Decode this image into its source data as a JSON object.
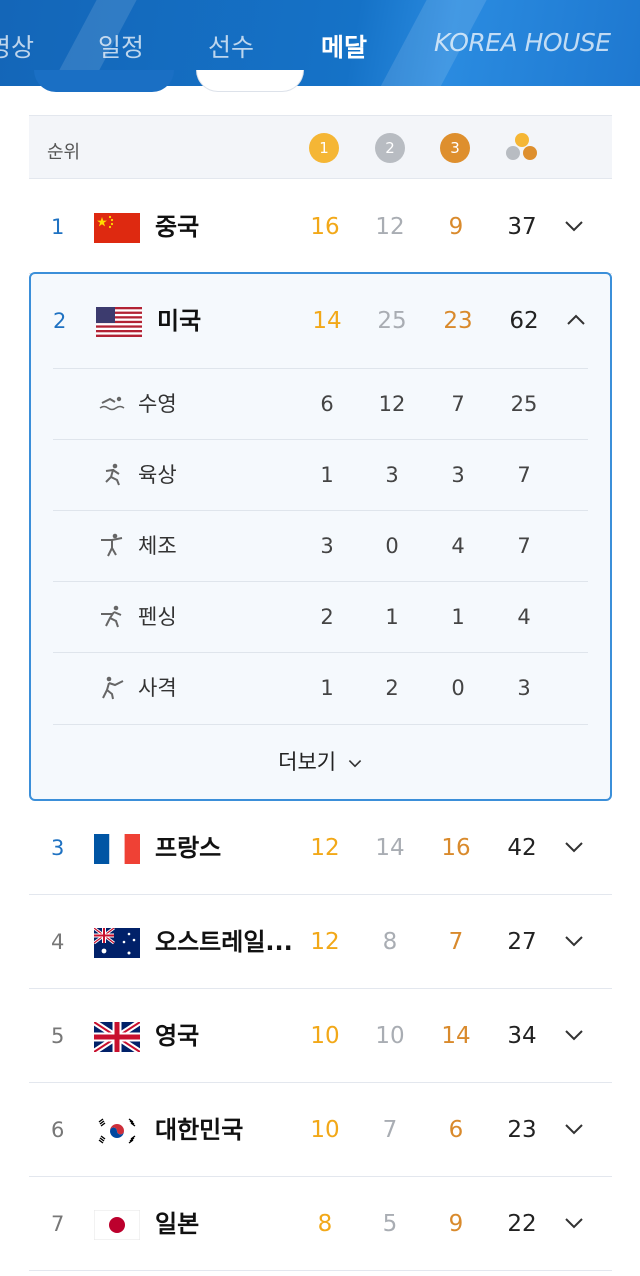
{
  "nav": {
    "items": [
      "영상",
      "일정",
      "선수",
      "메달",
      "KOREA HOUSE"
    ],
    "active": "메달"
  },
  "table": {
    "rank_header": "순위",
    "medal_headers": {
      "gold": "1",
      "silver": "2",
      "bronze": "3"
    }
  },
  "rows": [
    {
      "rank": "1",
      "country": "중국",
      "gold": "16",
      "silver": "12",
      "bronze": "9",
      "total": "37",
      "expanded": false
    },
    {
      "rank": "2",
      "country": "미국",
      "gold": "14",
      "silver": "25",
      "bronze": "23",
      "total": "62",
      "expanded": true
    },
    {
      "rank": "3",
      "country": "프랑스",
      "gold": "12",
      "silver": "14",
      "bronze": "16",
      "total": "42",
      "expanded": false
    },
    {
      "rank": "4",
      "country": "오스트레일...",
      "gold": "12",
      "silver": "8",
      "bronze": "7",
      "total": "27",
      "expanded": false
    },
    {
      "rank": "5",
      "country": "영국",
      "gold": "10",
      "silver": "10",
      "bronze": "14",
      "total": "34",
      "expanded": false
    },
    {
      "rank": "6",
      "country": "대한민국",
      "gold": "10",
      "silver": "7",
      "bronze": "6",
      "total": "23",
      "expanded": false
    },
    {
      "rank": "7",
      "country": "일본",
      "gold": "8",
      "silver": "5",
      "bronze": "9",
      "total": "22",
      "expanded": false
    }
  ],
  "usa_sports": [
    {
      "sport": "수영",
      "icon": "swimming-icon",
      "gold": "6",
      "silver": "12",
      "bronze": "7",
      "total": "25"
    },
    {
      "sport": "육상",
      "icon": "athletics-icon",
      "gold": "1",
      "silver": "3",
      "bronze": "3",
      "total": "7"
    },
    {
      "sport": "체조",
      "icon": "gymnastics-icon",
      "gold": "3",
      "silver": "0",
      "bronze": "4",
      "total": "7"
    },
    {
      "sport": "펜싱",
      "icon": "fencing-icon",
      "gold": "2",
      "silver": "1",
      "bronze": "1",
      "total": "4"
    },
    {
      "sport": "사격",
      "icon": "shooting-icon",
      "gold": "1",
      "silver": "2",
      "bronze": "0",
      "total": "3"
    }
  ],
  "more_label": "더보기",
  "colors": {
    "nav_bg": "#1572c7",
    "gold": "#f2a818",
    "silver": "#a9adb3",
    "bronze": "#d98a2c",
    "highlight_border": "#3b8fd9",
    "rank_blue": "#1f72c2"
  }
}
